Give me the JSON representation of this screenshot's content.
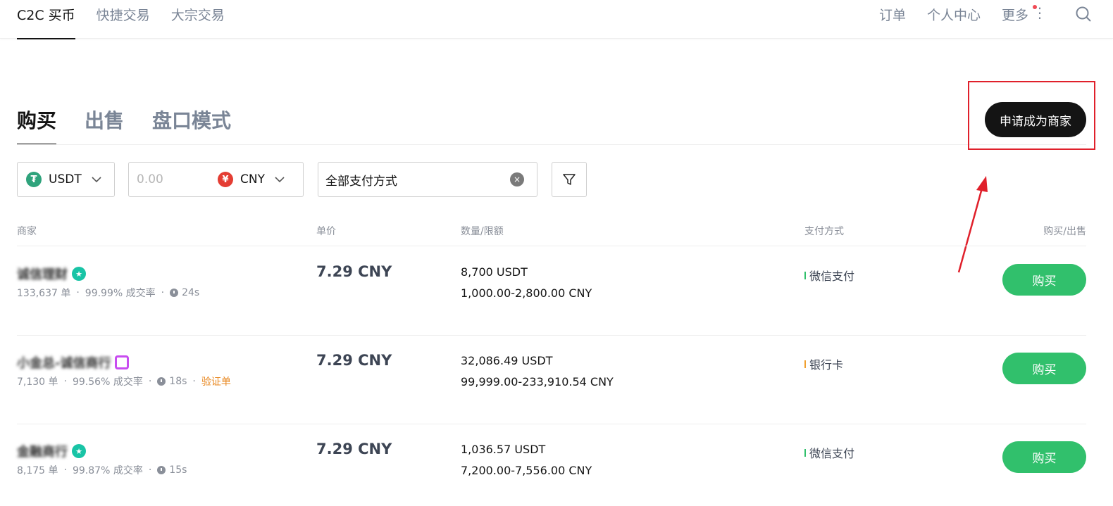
{
  "topnav": {
    "tabs": [
      {
        "label": "C2C 买币"
      },
      {
        "label": "快捷交易"
      },
      {
        "label": "大宗交易"
      }
    ],
    "orders_label": "订单",
    "profile_label": "个人中心",
    "more_label": "更多",
    "more_dots": "⋮"
  },
  "subtabs": [
    {
      "label": "购买"
    },
    {
      "label": "出售"
    },
    {
      "label": "盘口模式"
    }
  ],
  "merchant_button_label": "申请成为商家",
  "filters": {
    "coin": {
      "icon_glyph": "₮",
      "label": "USDT"
    },
    "amount": {
      "placeholder": "0.00",
      "currency_icon_glyph": "¥",
      "currency": "CNY"
    },
    "payment": {
      "label": "全部支付方式",
      "clear_glyph": "×"
    }
  },
  "table": {
    "headers": {
      "merchant": "商家",
      "price": "单价",
      "quantity": "数量/限额",
      "payment": "支付方式",
      "action": "购买/出售"
    },
    "rows": [
      {
        "name": "诚信理财",
        "badge": "star",
        "badge_glyph": "★",
        "orders": "133,637 单",
        "rate": "99.99% 成交率",
        "time": "24s",
        "verify": "",
        "price": "7.29 CNY",
        "quantity": "8,700 USDT",
        "limit": "1,000.00-2,800.00 CNY",
        "payment": "微信支付",
        "payment_color": "#31c06c",
        "action": "购买"
      },
      {
        "name": "小金总-诚信商行",
        "badge": "hex",
        "badge_glyph": "",
        "orders": "7,130 单",
        "rate": "99.56% 成交率",
        "time": "18s",
        "verify": "验证单",
        "price": "7.29 CNY",
        "quantity": "32,086.49 USDT",
        "limit": "99,999.00-233,910.54 CNY",
        "payment": "银行卡",
        "payment_color": "#f0a030",
        "action": "购买"
      },
      {
        "name": "金融商行",
        "badge": "star",
        "badge_glyph": "★",
        "orders": "8,175 单",
        "rate": "99.87% 成交率",
        "time": "15s",
        "verify": "",
        "price": "7.29 CNY",
        "quantity": "1,036.57 USDT",
        "limit": "7,200.00-7,556.00 CNY",
        "payment": "微信支付",
        "payment_color": "#31c06c",
        "action": "购买"
      }
    ]
  },
  "colors": {
    "buy_green": "#31c06c",
    "highlight_red": "#e0202b",
    "text_dark": "#141414",
    "text_muted": "#7a8596"
  }
}
